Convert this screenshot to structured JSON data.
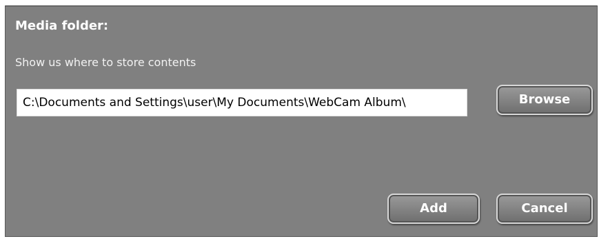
{
  "dialog": {
    "title": "Media folder:",
    "subtitle": "Show us where to store contents",
    "path_value": "C:\\Documents and Settings\\user\\My Documents\\WebCam Album\\",
    "browse_label": "Browse",
    "add_label": "Add",
    "cancel_label": "Cancel"
  },
  "colors": {
    "dialog_background": "#808080",
    "text": "#ffffff",
    "input_background": "#ffffff"
  }
}
